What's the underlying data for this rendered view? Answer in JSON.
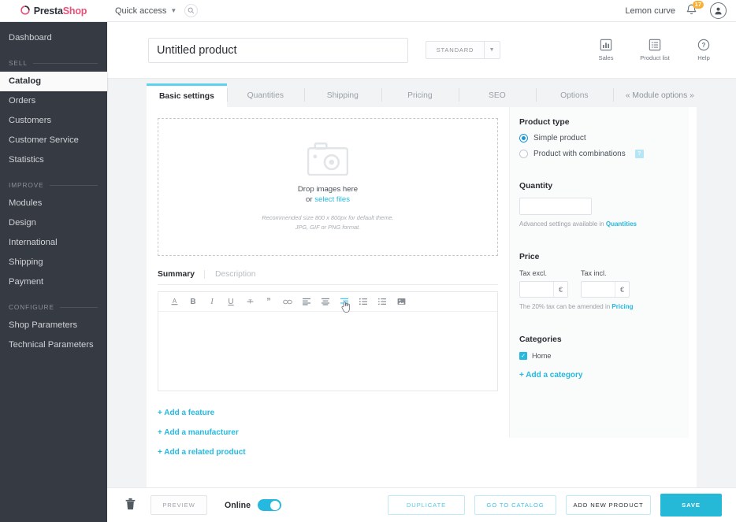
{
  "header": {
    "brand_first": "Presta",
    "brand_second": "Shop",
    "quick_access": "Quick access",
    "search_icon": "search-icon",
    "chevron_icon": "chevron-down-icon",
    "employee_name": "Lemon curve",
    "notifications_count": "17",
    "bell_icon": "bell-icon",
    "avatar_icon": "avatar-icon",
    "badge_color": "#fbb034"
  },
  "sidebar": {
    "items": [
      {
        "label": "Dashboard",
        "active": false
      },
      {
        "label": "Catalog",
        "active": true
      },
      {
        "label": "Orders",
        "active": false
      },
      {
        "label": "Customers",
        "active": false
      },
      {
        "label": "Customer Service",
        "active": false
      },
      {
        "label": "Statistics",
        "active": false
      },
      {
        "label": "Modules",
        "active": false
      },
      {
        "label": "Design",
        "active": false
      },
      {
        "label": "International",
        "active": false
      },
      {
        "label": "Shipping",
        "active": false
      },
      {
        "label": "Payment",
        "active": false
      },
      {
        "label": "Shop Parameters",
        "active": false
      },
      {
        "label": "Technical Parameters",
        "active": false
      }
    ],
    "sections": {
      "sell": "SELL",
      "improve": "IMPROVE",
      "configure": "CONFIGURE"
    },
    "background": "#363a42"
  },
  "page": {
    "title_value": "Untitled product",
    "title_placeholder": "Product name",
    "product_standard": "STANDARD",
    "toolbar": [
      {
        "label": "Sales",
        "icon": "bar-chart-icon"
      },
      {
        "label": "Product list",
        "icon": "list-icon"
      },
      {
        "label": "Help",
        "icon": "question-mark-icon"
      }
    ]
  },
  "tabs": [
    {
      "label": "Basic settings",
      "active": true
    },
    {
      "label": "Quantities",
      "active": false
    },
    {
      "label": "Shipping",
      "active": false
    },
    {
      "label": "Pricing",
      "active": false
    },
    {
      "label": "SEO",
      "active": false
    },
    {
      "label": "Options",
      "active": false
    },
    {
      "label": "« Module options »",
      "active": false
    }
  ],
  "dropzone": {
    "camera_icon": "camera-icon",
    "line1": "Drop images here",
    "or_text": "or ",
    "link_text": "select files",
    "hint_line1": "Recommended size 800 x 800px for default theme.",
    "hint_line2": "JPG, GIF or PNG format."
  },
  "description_tabs": {
    "summary": "Summary",
    "description": "Description"
  },
  "editor": {
    "value": "",
    "buttons": [
      {
        "icon": "text-color-icon",
        "glyph": "A",
        "active": false
      },
      {
        "icon": "bold-icon",
        "glyph": "B",
        "active": false
      },
      {
        "icon": "italic-icon",
        "glyph": "I",
        "active": false
      },
      {
        "icon": "underline-icon",
        "glyph": "U",
        "active": false
      },
      {
        "icon": "strikethrough-icon",
        "glyph": "S",
        "active": false
      },
      {
        "icon": "blockquote-icon",
        "glyph": "”",
        "active": false
      },
      {
        "icon": "link-icon",
        "glyph": "∞",
        "active": false
      },
      {
        "icon": "align-left-icon",
        "glyph": "",
        "active": false
      },
      {
        "icon": "align-center-icon",
        "glyph": "",
        "active": false
      },
      {
        "icon": "align-right-icon",
        "glyph": "",
        "active": true
      },
      {
        "icon": "bullet-list-icon",
        "glyph": "",
        "active": false
      },
      {
        "icon": "numbered-list-icon",
        "glyph": "",
        "active": false
      },
      {
        "icon": "insert-image-icon",
        "glyph": "",
        "active": false
      }
    ]
  },
  "add_links": [
    "+ Add a feature",
    "+ Add a manufacturer",
    "+ Add a related product"
  ],
  "right_panel": {
    "product_type_title": "Product type",
    "simple_product": "Simple product",
    "product_with_combinations": "Product with combinations",
    "help_badge": "?",
    "quantity_title": "Quantity",
    "quantity_value": "",
    "quantity_note_prefix": "Advanced settings available in ",
    "quantity_note_link": "Quantities",
    "price_title": "Price",
    "tax_excl_label": "Tax excl.",
    "tax_incl_label": "Tax incl.",
    "tax_excl_value": "",
    "tax_incl_value": "",
    "currency_symbol": "€",
    "price_note_prefix": "The 20% tax can be amended in ",
    "price_note_link": "Pricing",
    "categories_title": "Categories",
    "category_home": "Home",
    "add_category": "+ Add a category"
  },
  "footer": {
    "delete_icon": "trash-icon",
    "preview": "PREVIEW",
    "online_label": "Online",
    "online_state": true,
    "duplicate": "DUPLICATE",
    "go_to_catalog": "GO TO CATALOG",
    "add_new_product": "ADD NEW PRODUCT",
    "save": "SAVE",
    "accent_color": "#25b9d7"
  }
}
